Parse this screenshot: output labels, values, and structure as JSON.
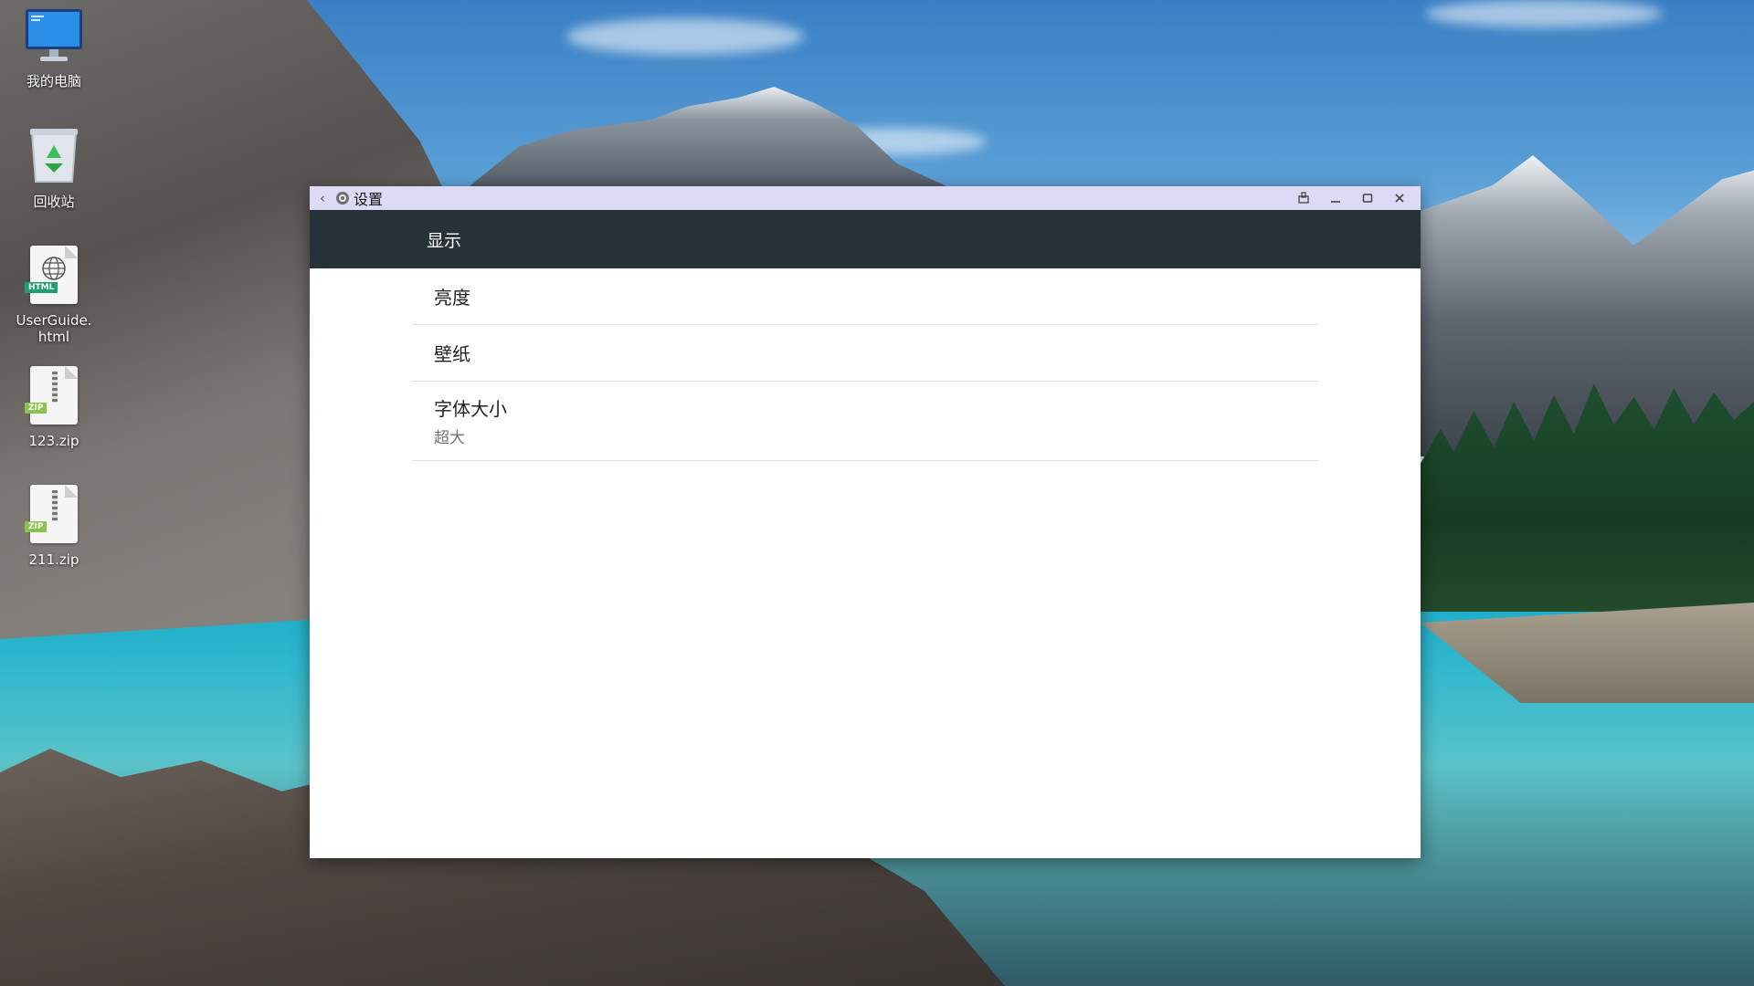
{
  "desktop": {
    "icons": [
      {
        "label": "我的电脑",
        "icon": "computer-icon"
      },
      {
        "label": "回收站",
        "icon": "recycle-bin-icon"
      },
      {
        "label": "UserGuide.\nhtml",
        "icon": "html-file-icon",
        "tag": "HTML"
      },
      {
        "label": "123.zip",
        "icon": "zip-file-icon",
        "tag": "ZIP"
      },
      {
        "label": "211.zip",
        "icon": "zip-file-icon",
        "tag": "ZIP"
      }
    ]
  },
  "window": {
    "title": "设置",
    "icons": {
      "back": "back-arrow-icon",
      "app": "settings-gear-icon",
      "rotate": "rotate-icon",
      "minimize": "minimize-icon",
      "maximize": "maximize-icon",
      "close": "close-icon"
    },
    "colors": {
      "titlebar": "#dcdaf5",
      "header": "#263238"
    }
  },
  "settings": {
    "header_title": "显示",
    "items": [
      {
        "title": "亮度"
      },
      {
        "title": "壁纸"
      },
      {
        "title": "字体大小",
        "subtitle": "超大"
      }
    ]
  }
}
